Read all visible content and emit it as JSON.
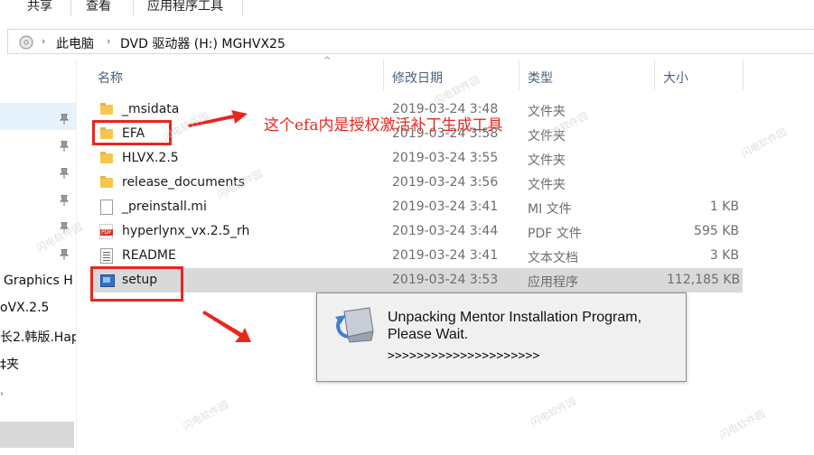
{
  "ribbon": {
    "tabs": [
      {
        "label": "共享"
      },
      {
        "label": "查看"
      },
      {
        "label": "应用程序工具"
      }
    ]
  },
  "address": {
    "segments": [
      "此电脑",
      "DVD 驱动器 (H:) MGHVX25"
    ]
  },
  "nav": {
    "items": [
      "Graphics H",
      "oVX.2.5",
      "长2.韩版.Hap",
      "‡夹"
    ]
  },
  "columns": {
    "name": "名称",
    "date": "修改日期",
    "type": "类型",
    "size": "大小"
  },
  "files": [
    {
      "icon": "folder-icon",
      "name": "_msidata",
      "date": "2019-03-24 3:48",
      "type": "文件夹",
      "size": ""
    },
    {
      "icon": "folder-icon",
      "name": "EFA",
      "date": "2019-03-24 3:58",
      "type": "文件夹",
      "size": ""
    },
    {
      "icon": "folder-icon",
      "name": "HLVX.2.5",
      "date": "2019-03-24 3:55",
      "type": "文件夹",
      "size": ""
    },
    {
      "icon": "folder-icon",
      "name": "release_documents",
      "date": "2019-03-24 3:56",
      "type": "文件夹",
      "size": ""
    },
    {
      "icon": "document-icon",
      "name": "_preinstall.mi",
      "date": "2019-03-24 3:41",
      "type": "MI 文件",
      "size": "1 KB"
    },
    {
      "icon": "pdf-icon",
      "name": "hyperlynx_vx.2.5_rh",
      "date": "2019-03-24 3:44",
      "type": "PDF 文件",
      "size": "595 KB"
    },
    {
      "icon": "text-file-icon",
      "name": "README",
      "date": "2019-03-24 3:41",
      "type": "文本文档",
      "size": "3 KB"
    },
    {
      "icon": "installer-icon",
      "name": "setup",
      "date": "2019-03-24 3:53",
      "type": "应用程序",
      "size": "112,185 KB"
    }
  ],
  "annotation": {
    "text": "这个efa内是授权激活补丁生成工具",
    "color": "#e8261e"
  },
  "dialog": {
    "line1": "Unpacking Mentor Installation Program,",
    "line2": "Please Wait.",
    "progress": ">>>>>>>>>>>>>>>>>>>>>"
  },
  "watermark": {
    "text": "闪电软件园"
  },
  "colors": {
    "selection": "#d9d9d9",
    "nav_selected": "#e5f1fb",
    "annotation_red": "#e8261e",
    "folder": "#f6c74e"
  }
}
